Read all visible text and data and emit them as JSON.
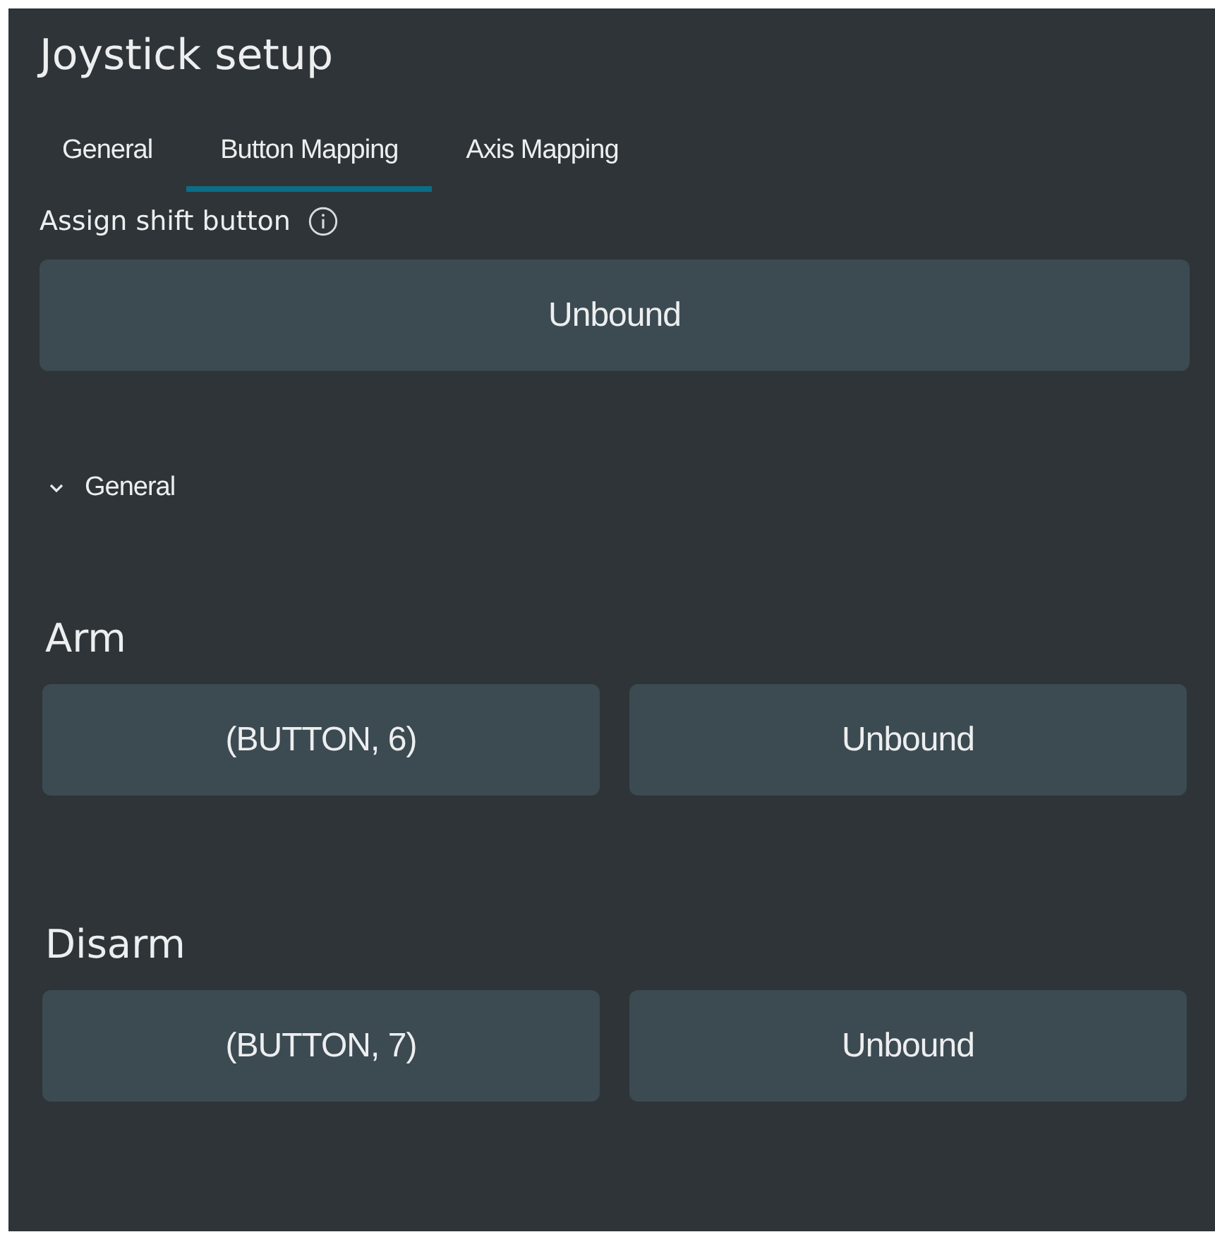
{
  "window": {
    "title": "Joystick setup"
  },
  "tabs": [
    {
      "label": "General",
      "selected": false
    },
    {
      "label": "Button Mapping",
      "selected": true
    },
    {
      "label": "Axis Mapping",
      "selected": false
    }
  ],
  "shift_button": {
    "label": "Assign shift button",
    "value": "Unbound"
  },
  "section": {
    "title": "General",
    "expanded": true
  },
  "actions": [
    {
      "name": "Arm",
      "bindings": [
        "(BUTTON, 6)",
        "Unbound"
      ]
    },
    {
      "name": "Disarm",
      "bindings": [
        "(BUTTON, 7)",
        "Unbound"
      ]
    }
  ]
}
